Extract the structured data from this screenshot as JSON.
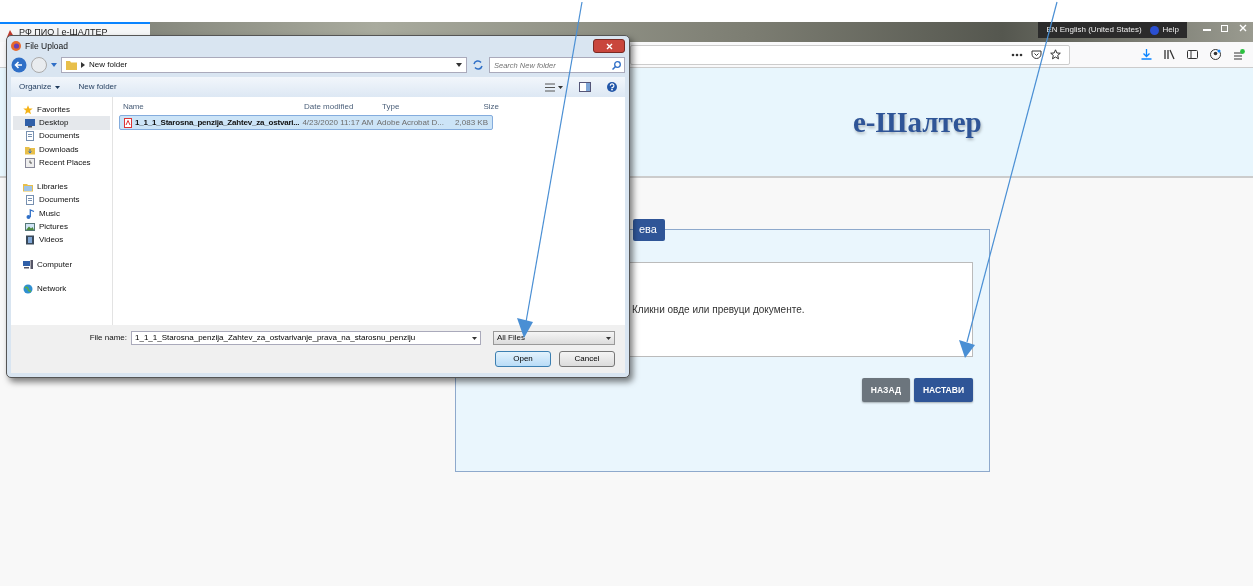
{
  "browser": {
    "tab": {
      "title": "РФ ПИО | е-ШАЛТЕР"
    },
    "tray": {
      "language": "EN English (United States)",
      "help": "Help"
    }
  },
  "page": {
    "heading": "е-Шалтер",
    "panel_tab": "ева",
    "dropzone": {
      "text": "Кликни овде или превуци документе."
    },
    "buttons": [
      {
        "label": "НАЗАД",
        "kind": "secondary"
      },
      {
        "label": "НАСТАВИ",
        "kind": "primary"
      }
    ]
  },
  "dialog": {
    "title": "File Upload",
    "path": "New folder",
    "search": {
      "placeholder": "Search New folder"
    },
    "commands": [
      {
        "label": "Organize",
        "dropdown": true
      },
      {
        "label": "New folder",
        "dropdown": false
      }
    ],
    "sidebar": [
      {
        "label": "Favorites",
        "kind": "star",
        "selected": false,
        "children": [
          {
            "label": "Desktop",
            "kind": "desktop",
            "selected": true
          },
          {
            "label": "Documents",
            "kind": "document",
            "selected": false
          },
          {
            "label": "Downloads",
            "kind": "downloads",
            "selected": false
          },
          {
            "label": "Recent Places",
            "kind": "recent",
            "selected": false
          }
        ]
      },
      {
        "label": "Libraries",
        "kind": "library",
        "selected": false,
        "children": [
          {
            "label": "Documents",
            "kind": "document",
            "selected": false
          },
          {
            "label": "Music",
            "kind": "music",
            "selected": false
          },
          {
            "label": "Pictures",
            "kind": "pictures",
            "selected": false
          },
          {
            "label": "Videos",
            "kind": "videos",
            "selected": false
          }
        ]
      },
      {
        "label": "Computer",
        "kind": "computer",
        "selected": false
      },
      {
        "label": "Network",
        "kind": "network",
        "selected": false
      }
    ],
    "columns": [
      "Name",
      "Date modified",
      "Type",
      "Size"
    ],
    "rows": [
      {
        "cells": [
          "1_1_1_Starosna_penzija_Zahtev_za_ostvari...",
          "4/23/2020 11:17 AM",
          "Adobe Acrobat D...",
          "2,083 KB"
        ],
        "selected": true
      }
    ],
    "file_name_label": "File name:",
    "file_name": "1_1_1_Starosna_penzija_Zahtev_za_ostvarivanje_prava_na_starosnu_penziju",
    "file_type": "All Files",
    "buttons": [
      {
        "label": "Open",
        "default": true
      },
      {
        "label": "Cancel",
        "default": false
      }
    ]
  }
}
